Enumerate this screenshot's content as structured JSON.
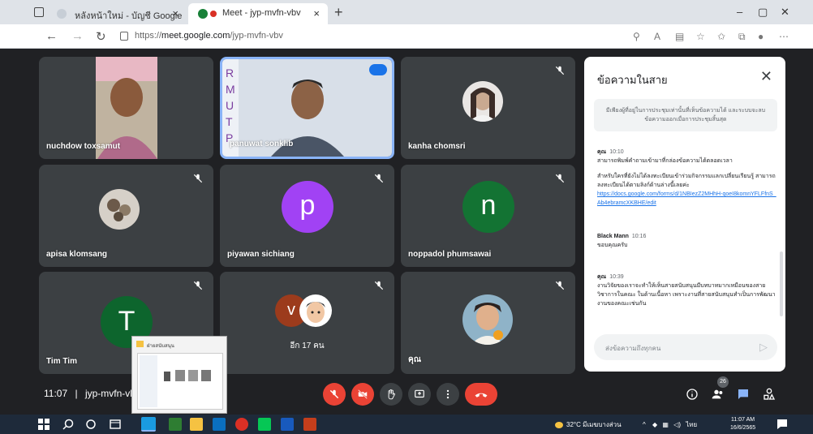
{
  "browser": {
    "tabs": [
      {
        "title": "หลังหน้าใหม่ - บัญชี Google",
        "active": false
      },
      {
        "title": "Meet - jyp-mvfn-vbv",
        "active": true
      }
    ],
    "url_prefix": "https://",
    "url_host": "meet.google.com",
    "url_path": "/jyp-mvfn-vbv",
    "window_controls": [
      "–",
      "▢",
      "✕"
    ]
  },
  "participants": [
    {
      "name": "nuchdow toxsamut",
      "kind": "video"
    },
    {
      "name": "panuwat sonklib",
      "kind": "video",
      "speaking": true
    },
    {
      "name": "kanha chomsri",
      "kind": "photo"
    },
    {
      "name": "apisa klomsang",
      "kind": "photo"
    },
    {
      "name": "piyawan sichiang",
      "kind": "letter",
      "letter": "p",
      "color": "#a142f4"
    },
    {
      "name": "noppadol phumsawai",
      "kind": "letter",
      "letter": "n",
      "color": "#137333"
    },
    {
      "name": "Tim Tim",
      "kind": "letter",
      "letter": "T",
      "color": "#0d652d"
    },
    {
      "name": "อีก 17 คน",
      "kind": "group",
      "letter": "v",
      "color": "#9c3b1c"
    },
    {
      "name": "คุณ",
      "kind": "photo"
    }
  ],
  "chat": {
    "title": "ข้อความในสาย",
    "notice": "มีเพียงผู้ที่อยู่ในการประชุมเท่านั้นที่เห็นข้อความได้ และระบบจะลบข้อความออกเมื่อการประชุมสิ้นสุด",
    "messages": [
      {
        "sender": "คุณ",
        "time": "10:10",
        "lines": [
          "สามารถพิมพ์คำถามเข้ามาที่กล่องข้อความได้ตลอดเวลา",
          "สำหรับใครที่ยังไม่ได้ลงทะเบียนเข้าร่วมกิจกรรมแลกเปลี่ยนเรียนรู้ สามารถลงทะเบียนได้ตามลิงก์ด้านล่างนี้เลยค่ะ"
        ],
        "link": "https://docs.google.com/forms/d/1NBIezZ2MHhH-qoeI8komnYFLFfnS_Ab4ebramcXKBHE/edit"
      },
      {
        "sender": "Black Mann",
        "time": "10:16",
        "lines": [
          "ขอบคุณครับ"
        ]
      },
      {
        "sender": "คุณ",
        "time": "10:39",
        "lines": [
          "งานวิจัยของเราจะทำให้เห็นสายสนับสนุนมีบทบาทมากเหมือนของสายวิชาการในคณะ ในด้านเนื้อหา เพราะงานที่สายสนับสนุนทำเป็นการพัฒนางานของคณะเช่นกัน"
        ]
      }
    ],
    "input_placeholder": "ส่งข้อความถึงทุกคน"
  },
  "bottom": {
    "time": "11:07",
    "separator": "|",
    "meeting_code": "jyp-mvfn-vbv",
    "people_count": "26"
  },
  "thumbnail": {
    "title": "ฝ่ายสนับสนุน"
  },
  "taskbar": {
    "weather": "32°C มีเมฆบางส่วน",
    "lang": "ไทย",
    "time": "11:07 AM",
    "date": "16/6/2565"
  },
  "colors": {
    "meet_bg": "#202124",
    "tile_bg": "#3c4043",
    "red": "#ea4335",
    "active_border": "#8ab4f8",
    "link": "#1a73e8"
  }
}
